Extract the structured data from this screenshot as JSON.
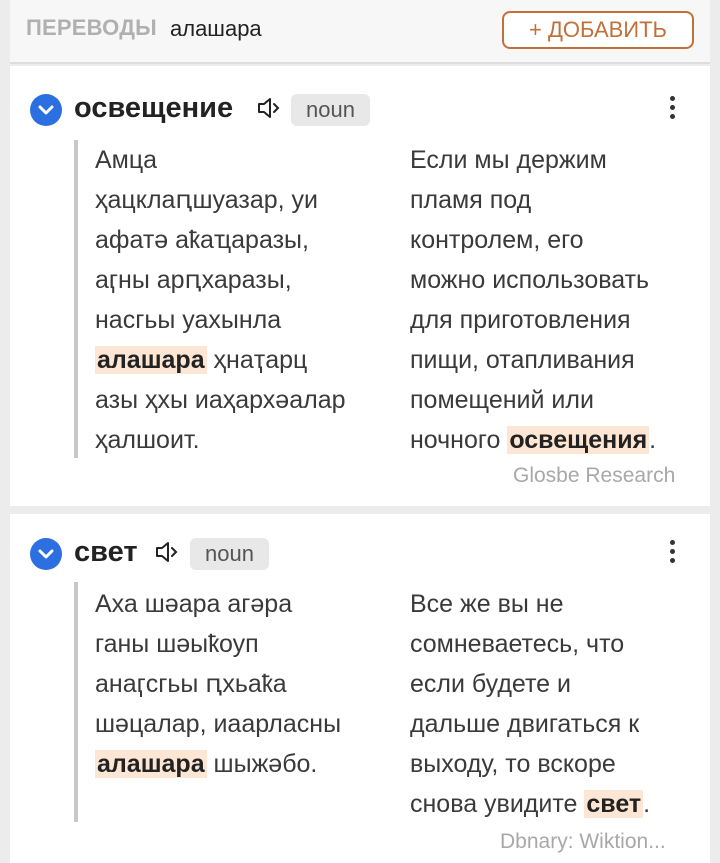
{
  "header": {
    "label": "ПЕРЕВОДЫ",
    "word": "алашара",
    "add_button": "+ ДОБАВИТЬ"
  },
  "entries": [
    {
      "term": "освещение",
      "pos": "noun",
      "source_lines": [
        [
          "Амца"
        ],
        [
          "ҳацклаԥшуазар, уи"
        ],
        [
          "афатә аҟаҵаразы,"
        ],
        [
          "аӷны арԥхаразы,"
        ],
        [
          "насгьы уахынла"
        ],
        [
          "",
          "алашара",
          " ҳнаҭарц"
        ],
        [
          "азы ҳхы иаҳархәалар"
        ],
        [
          "ҳалшоит."
        ]
      ],
      "target_lines": [
        [
          "Если мы держим"
        ],
        [
          "пламя под"
        ],
        [
          "контролем, его"
        ],
        [
          "можно использовать"
        ],
        [
          "для приготовления"
        ],
        [
          "пищи, отапливания"
        ],
        [
          "помещений или"
        ],
        [
          "ночного ",
          "освещения",
          "."
        ]
      ],
      "attribution": "Glosbe Research"
    },
    {
      "term": "свет",
      "pos": "noun",
      "source_lines": [
        [
          "Аха шәара агәра"
        ],
        [
          "ганы шәыҟоуп"
        ],
        [
          "анаӷсгьы ԥхьаҟа"
        ],
        [
          "шәцалар, иаарласны"
        ],
        [
          "",
          "алашара",
          " шыжәбо."
        ]
      ],
      "target_lines": [
        [
          "Все же вы не"
        ],
        [
          "сомневаетесь, что"
        ],
        [
          "если будете и"
        ],
        [
          "дальше двигаться к"
        ],
        [
          "выходу, то вскоре"
        ],
        [
          "снова увидите ",
          "свет",
          "."
        ]
      ],
      "attribution": "Dbnary: Wiktion..."
    }
  ],
  "icons": {
    "expand": "chevron-down-icon",
    "audio": "speaker-icon",
    "menu": "more-vertical-icon"
  },
  "colors": {
    "accent": "#c2703a",
    "chevron_bg": "#2b6fe0",
    "highlight_bg": "#fde6d4"
  }
}
